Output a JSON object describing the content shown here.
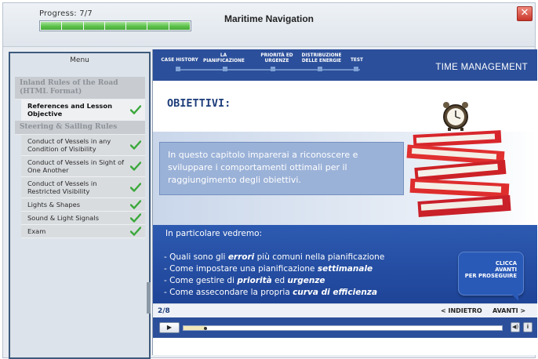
{
  "header": {
    "progress_label": "Progress: 7/7",
    "progress_fraction": 1.0,
    "title": "Maritime Navigation",
    "close_icon": "close-x-icon"
  },
  "sidebar": {
    "title": "Menu",
    "sections": [
      {
        "label": "Inland Rules of the Road (HTML Format)",
        "items": [
          {
            "label": "References and Lesson Objective",
            "completed": true,
            "active": true
          }
        ]
      },
      {
        "label": "Steering & Sailing Rules",
        "items": [
          {
            "label": "Conduct of Vessels in any Condition of Visibility",
            "completed": true
          },
          {
            "label": "Conduct of Vessels in Sight of One Another",
            "completed": true
          },
          {
            "label": "Conduct of Vessels in Restricted Visibility",
            "completed": true
          },
          {
            "label": "Lights & Shapes",
            "completed": true
          },
          {
            "label": "Sound & Light Signals",
            "completed": true
          },
          {
            "label": "Exam",
            "completed": true
          }
        ]
      }
    ]
  },
  "content": {
    "nav_tabs": [
      "CASE HISTORY",
      "LA PIANIFICAZIONE",
      "PRIORITÀ ED URGENZE",
      "DISTRIBUZIONE DELLE ENERGIE",
      "TEST"
    ],
    "module_title": "TIME MANAGEMENT",
    "heading": "OBIETTIVI:",
    "intro": "In questo capitolo imparerai a riconoscere e sviluppare i comportamenti ottimali per il raggiungimento degli obiettivi.",
    "panel_title": "In particolare vedremo:",
    "bullets": [
      {
        "before": "- Quali sono gli ",
        "em": "errori",
        "after": " più comuni nella pianificazione"
      },
      {
        "before": "- Come impostare una pianificazione ",
        "em": "settimanale",
        "after": ""
      },
      {
        "before": "- Come gestire di ",
        "em": "priorità",
        "mid": " ed ",
        "em2": "urgenze",
        "after": ""
      },
      {
        "before": "- Come assecondare la propria ",
        "em": "curva di efficienza",
        "after": ""
      }
    ],
    "cta": [
      "CLICCA",
      "AVANTI",
      "PER PROSEGUIRE"
    ],
    "page": "2/8",
    "prev_label": "< INDIETRO",
    "next_label": "AVANTI >",
    "playback_fraction": 0.07
  },
  "colors": {
    "accent_blue": "#2b4f9a",
    "check_green": "#3aa83a",
    "progress_green": "#5cc24a"
  }
}
